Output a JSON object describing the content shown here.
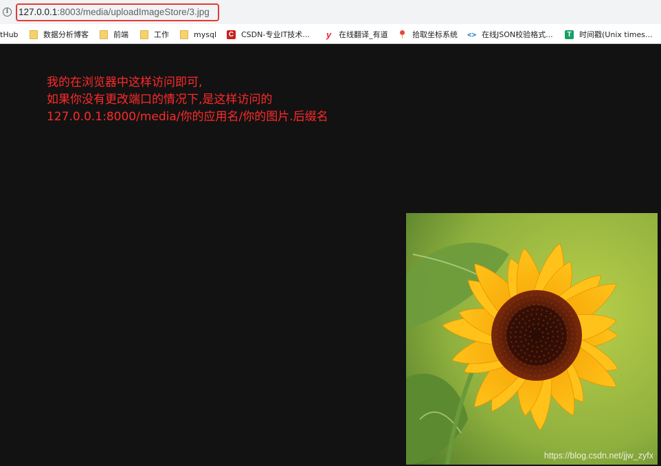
{
  "address_bar": {
    "url_host": "127.0.0.1",
    "url_path": ":8003/media/uploadImageStore/3.jpg",
    "highlight_color": "#e53935"
  },
  "bookmarks": [
    {
      "label": "tHub",
      "icon": "none"
    },
    {
      "label": "数据分析博客",
      "icon": "folder-icon"
    },
    {
      "label": "前端",
      "icon": "folder-icon"
    },
    {
      "label": "工作",
      "icon": "folder-icon"
    },
    {
      "label": "mysql",
      "icon": "folder-icon"
    },
    {
      "label": "CSDN-专业IT技术...",
      "icon": "csdn-icon",
      "glyph": "C"
    },
    {
      "label": "在线翻译_有道",
      "icon": "youdao-icon",
      "glyph": "y"
    },
    {
      "label": "拾取坐标系统",
      "icon": "map-pin-icon"
    },
    {
      "label": "在线JSON校验格式...",
      "icon": "code-icon",
      "glyph": "<>"
    },
    {
      "label": "时间戳(Unix times...",
      "icon": "timestamp-icon",
      "glyph": "T"
    }
  ],
  "annotation": {
    "line1": "我的在浏览器中这样访问即可,",
    "line2": "如果你没有更改端口的情况下,是这样访问的",
    "line3": "127.0.0.1:8000/media/你的应用名/你的图片.后缀名",
    "color": "#ff2a2a"
  },
  "image": {
    "subject": "sunflower",
    "watermark": "https://blog.csdn.net/jjw_zyfx"
  },
  "colors": {
    "page_background": "#121212",
    "petal": "#f7b500",
    "center": "#4a1a0a",
    "leaf": "#6d9a3a"
  }
}
